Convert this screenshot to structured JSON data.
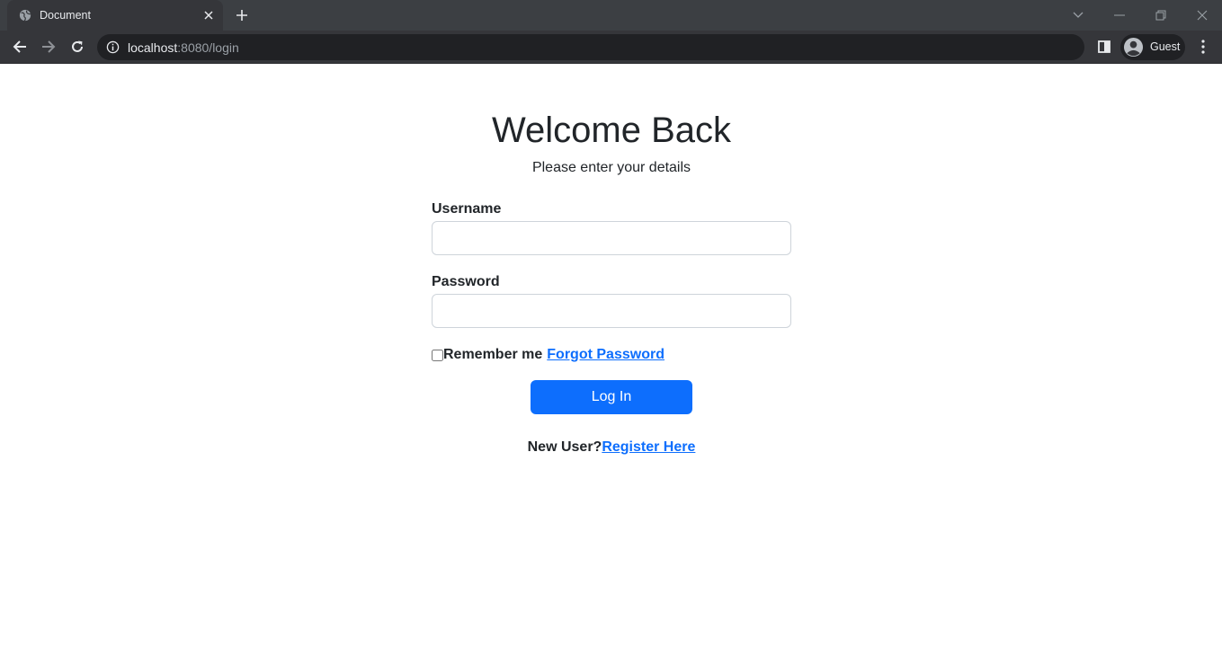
{
  "browser": {
    "tab_title": "Document",
    "url_host": "localhost",
    "url_rest": ":8080/login",
    "profile_name": "Guest"
  },
  "page": {
    "title": "Welcome Back",
    "subtitle": "Please enter your details",
    "username_label": "Username",
    "username_value": "",
    "password_label": "Password",
    "password_value": "",
    "remember_label": "Remember me",
    "remember_checked": false,
    "forgot_link": "Forgot Password",
    "login_button": "Log In",
    "new_user_text": "New User?",
    "register_link": "Register Here"
  },
  "colors": {
    "primary": "#0d6efd",
    "text": "#212529",
    "chrome_dark": "#35363a"
  }
}
